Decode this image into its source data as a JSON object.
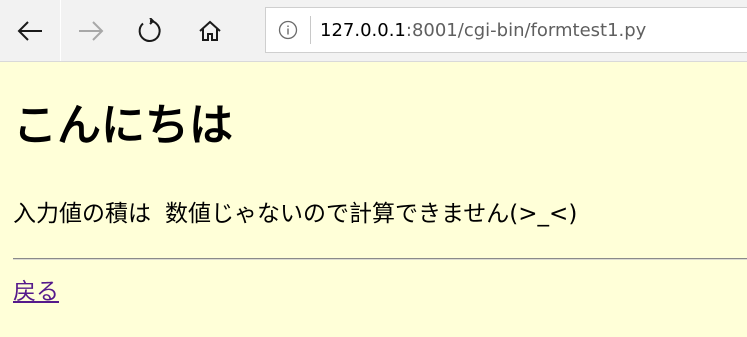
{
  "browser": {
    "url_host": "127.0.0.1",
    "url_rest": ":8001/cgi-bin/formtest1.py",
    "icons": {
      "back": "back-arrow-icon",
      "forward": "forward-arrow-icon",
      "refresh": "refresh-icon",
      "home": "home-icon",
      "info": "info-icon"
    }
  },
  "page": {
    "heading": "こんにちは",
    "result_label": "入力値の積は",
    "result_message": "数値じゃないので計算できません(>_<)",
    "back_link": "戻る"
  },
  "colors": {
    "page_background": "#ffffd8",
    "toolbar_background": "#f2f2f2",
    "visited_link": "#551a8b"
  }
}
